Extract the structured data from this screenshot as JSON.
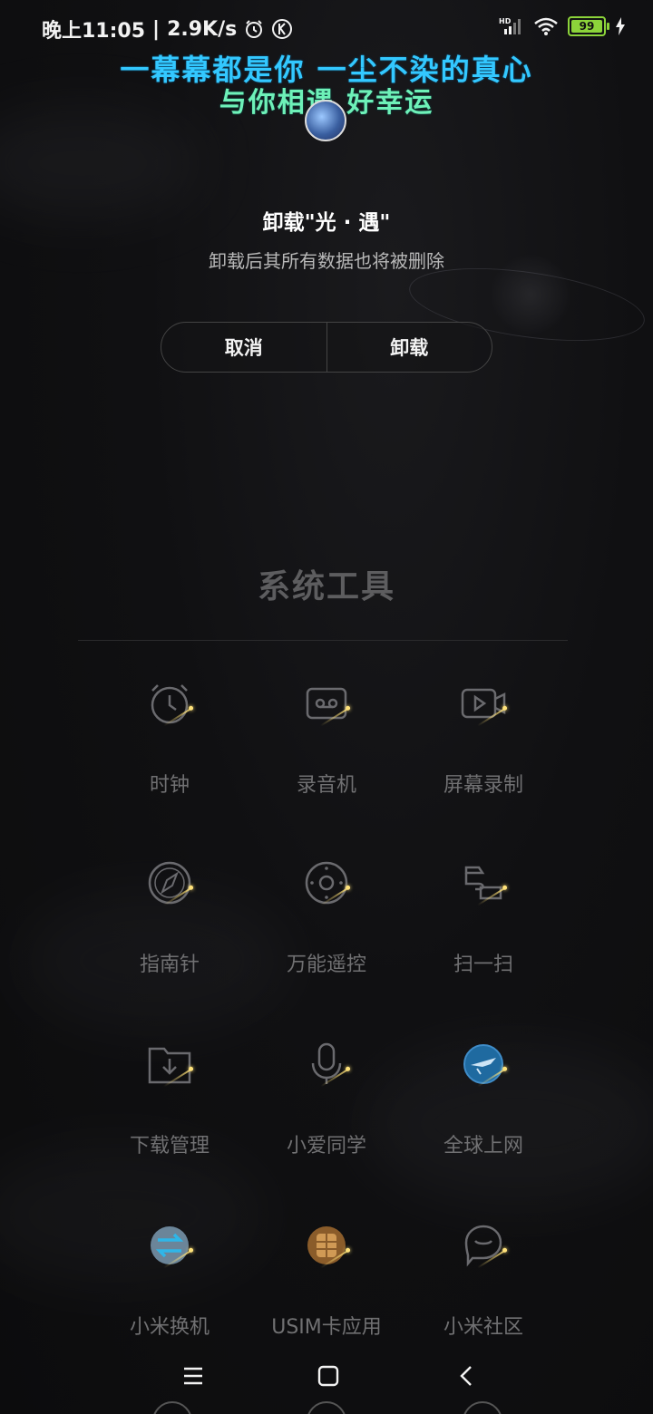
{
  "status_bar": {
    "time": "晚上11:05",
    "net_speed": "2.9K/s",
    "battery": "99"
  },
  "lyrics": {
    "line1": "一幕幕都是你 一尘不染的真心",
    "line2": "与你相遇 好幸运"
  },
  "dialog": {
    "title": "卸载\"光 · 遇\"",
    "description": "卸载后其所有数据也将被删除",
    "cancel_label": "取消",
    "confirm_label": "卸载"
  },
  "folder": {
    "title": "系统工具",
    "apps": [
      {
        "label": "时钟",
        "icon": "clock-icon"
      },
      {
        "label": "录音机",
        "icon": "recorder-icon"
      },
      {
        "label": "屏幕录制",
        "icon": "screen-record-icon"
      },
      {
        "label": "指南针",
        "icon": "compass-icon"
      },
      {
        "label": "万能遥控",
        "icon": "remote-icon"
      },
      {
        "label": "扫一扫",
        "icon": "scanner-icon"
      },
      {
        "label": "下载管理",
        "icon": "download-icon"
      },
      {
        "label": "小爱同学",
        "icon": "microphone-icon"
      },
      {
        "label": "全球上网",
        "icon": "globe-plane-icon"
      },
      {
        "label": "小米换机",
        "icon": "transfer-icon"
      },
      {
        "label": "USIM卡应用",
        "icon": "sim-card-icon"
      },
      {
        "label": "小米社区",
        "icon": "community-icon"
      }
    ]
  },
  "colors": {
    "lyric_primary": "#33c8ff",
    "lyric_secondary": "#6ef1b8",
    "battery": "#8cd43a"
  },
  "nav": {
    "items": [
      "menu-icon",
      "home-icon",
      "back-icon"
    ]
  }
}
